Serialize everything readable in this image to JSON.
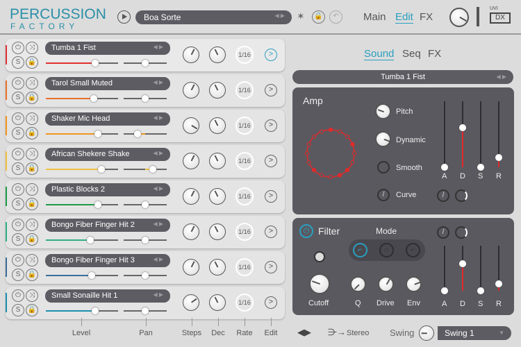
{
  "header": {
    "logo_top": "PERCUSSION",
    "logo_bottom": "FACTORY",
    "preset": "Boa Sorte",
    "nav": [
      "Main",
      "Edit",
      "FX"
    ],
    "nav_active": "Edit",
    "brand": "UVI"
  },
  "colors": {
    "accent": "#2a9fc0",
    "panel": "#5a5960",
    "env": "#e02a2a"
  },
  "tracks": [
    {
      "name": "Tumba 1 Fist",
      "color": "#e03030",
      "level": 0.68,
      "pan": 0.5,
      "steps": 0.4,
      "dec": 0.6,
      "rate": "1/16",
      "selected": true
    },
    {
      "name": "Tarol Small Muted",
      "color": "#e8702a",
      "level": 0.66,
      "pan": 0.5,
      "steps": 0.4,
      "dec": 0.6,
      "rate": "1/16"
    },
    {
      "name": "Shaker Mic Head",
      "color": "#f0961e",
      "level": 0.72,
      "pan": 0.33,
      "steps": 0.05,
      "dec": 0.6,
      "rate": "1/16"
    },
    {
      "name": "African Shekere Shake",
      "color": "#f0c040",
      "level": 0.77,
      "pan": 0.68,
      "steps": 0.4,
      "dec": 0.6,
      "rate": "1/16"
    },
    {
      "name": "Plastic Blocks 2",
      "color": "#1f9a4a",
      "level": 0.72,
      "pan": 0.5,
      "steps": 0.4,
      "dec": 0.6,
      "rate": "1/16"
    },
    {
      "name": "Bongo Fiber Finger Hit 2",
      "color": "#2fae86",
      "level": 0.62,
      "pan": 0.5,
      "steps": 0.4,
      "dec": 0.6,
      "rate": "1/16"
    },
    {
      "name": "Bongo Fiber Finger Hit 3",
      "color": "#3a6e9a",
      "level": 0.63,
      "pan": 0.5,
      "steps": 0.4,
      "dec": 0.6,
      "rate": "1/16"
    },
    {
      "name": "Small Sonaille Hit 1",
      "color": "#1a8fae",
      "level": 0.68,
      "pan": 0.5,
      "steps": 0.3,
      "dec": 0.6,
      "rate": "1/16"
    }
  ],
  "track_buttons": {
    "power": "⏻",
    "shuffle": "⤨",
    "solo": "S",
    "lock": "🔒",
    "edit": ">"
  },
  "right": {
    "tabs": [
      "Sound",
      "Seq",
      "FX"
    ],
    "active_tab": "Sound",
    "selected_sound": "Tumba 1 Fist"
  },
  "amp": {
    "title": "Amp",
    "knobs": [
      "Pitch",
      "Dynamic",
      "Smooth",
      "Curve"
    ],
    "adsr": [
      "A",
      "D",
      "S",
      "R"
    ],
    "adsr_values": [
      0,
      0.6,
      0,
      0.15
    ]
  },
  "filter": {
    "title": "Filter",
    "mode_label": "Mode",
    "modes": [
      "lowpass",
      "bandpass",
      "highpass"
    ],
    "active_mode": "lowpass",
    "knobs": [
      "Cutoff",
      "Q",
      "Drive",
      "Env"
    ],
    "adsr": [
      "A",
      "D",
      "S",
      "R"
    ],
    "adsr_values": [
      0,
      0.6,
      0,
      0.15
    ]
  },
  "footer": {
    "labels": [
      "Level",
      "Pan",
      "Steps",
      "Dec",
      "Rate",
      "Edit"
    ],
    "output": "Stereo",
    "swing_label": "Swing",
    "swing_value": "Swing 1"
  }
}
